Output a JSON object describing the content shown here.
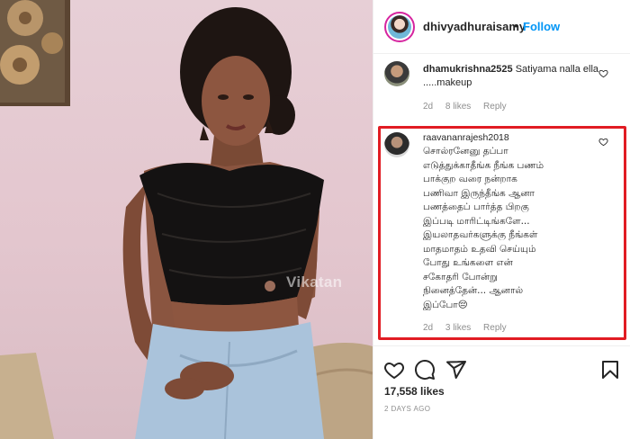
{
  "photo": {
    "watermark": "Vikatan"
  },
  "header": {
    "username": "dhivyadhuraisamy",
    "separator": "•",
    "follow_label": "Follow"
  },
  "comments": [
    {
      "username": "dhamukrishna2525",
      "text": "Satiyama nalla ella .....makeup",
      "age": "2d",
      "likes": "8 likes",
      "reply": "Reply"
    },
    {
      "username": "raavananrajesh2018",
      "lines": [
        "சொல்ரனேனு தப்பா",
        "எடுத்துக்காதீங்க நீங்க பணம்",
        "பாக்குற வரை நன்றாக",
        "பணிவா இருந்தீங்க ஆனா",
        "பணத்தைப் பார்த்த பிறகு",
        "இப்படி மாரிட்டிங்களே...",
        "இயலாதவர்களுக்கு நீங்கள்",
        "மாதமாதம் உதவி செய்யும்",
        "போது உங்களை என்",
        "சகோதரி போன்று",
        "நினைத்தேன்... ஆனால்",
        "இப்போ😔"
      ],
      "age": "2d",
      "likes": "3 likes",
      "reply": "Reply"
    }
  ],
  "post": {
    "likes": "17,558 likes",
    "posted": "2 DAYS AGO"
  },
  "icons": [
    "heart-icon",
    "comment-icon",
    "share-icon",
    "bookmark-icon",
    "comment-like-icon"
  ],
  "colors": {
    "accent": "#0095f6",
    "highlight": "#e11c23",
    "muted": "#8e8e8e",
    "text": "#262626"
  }
}
